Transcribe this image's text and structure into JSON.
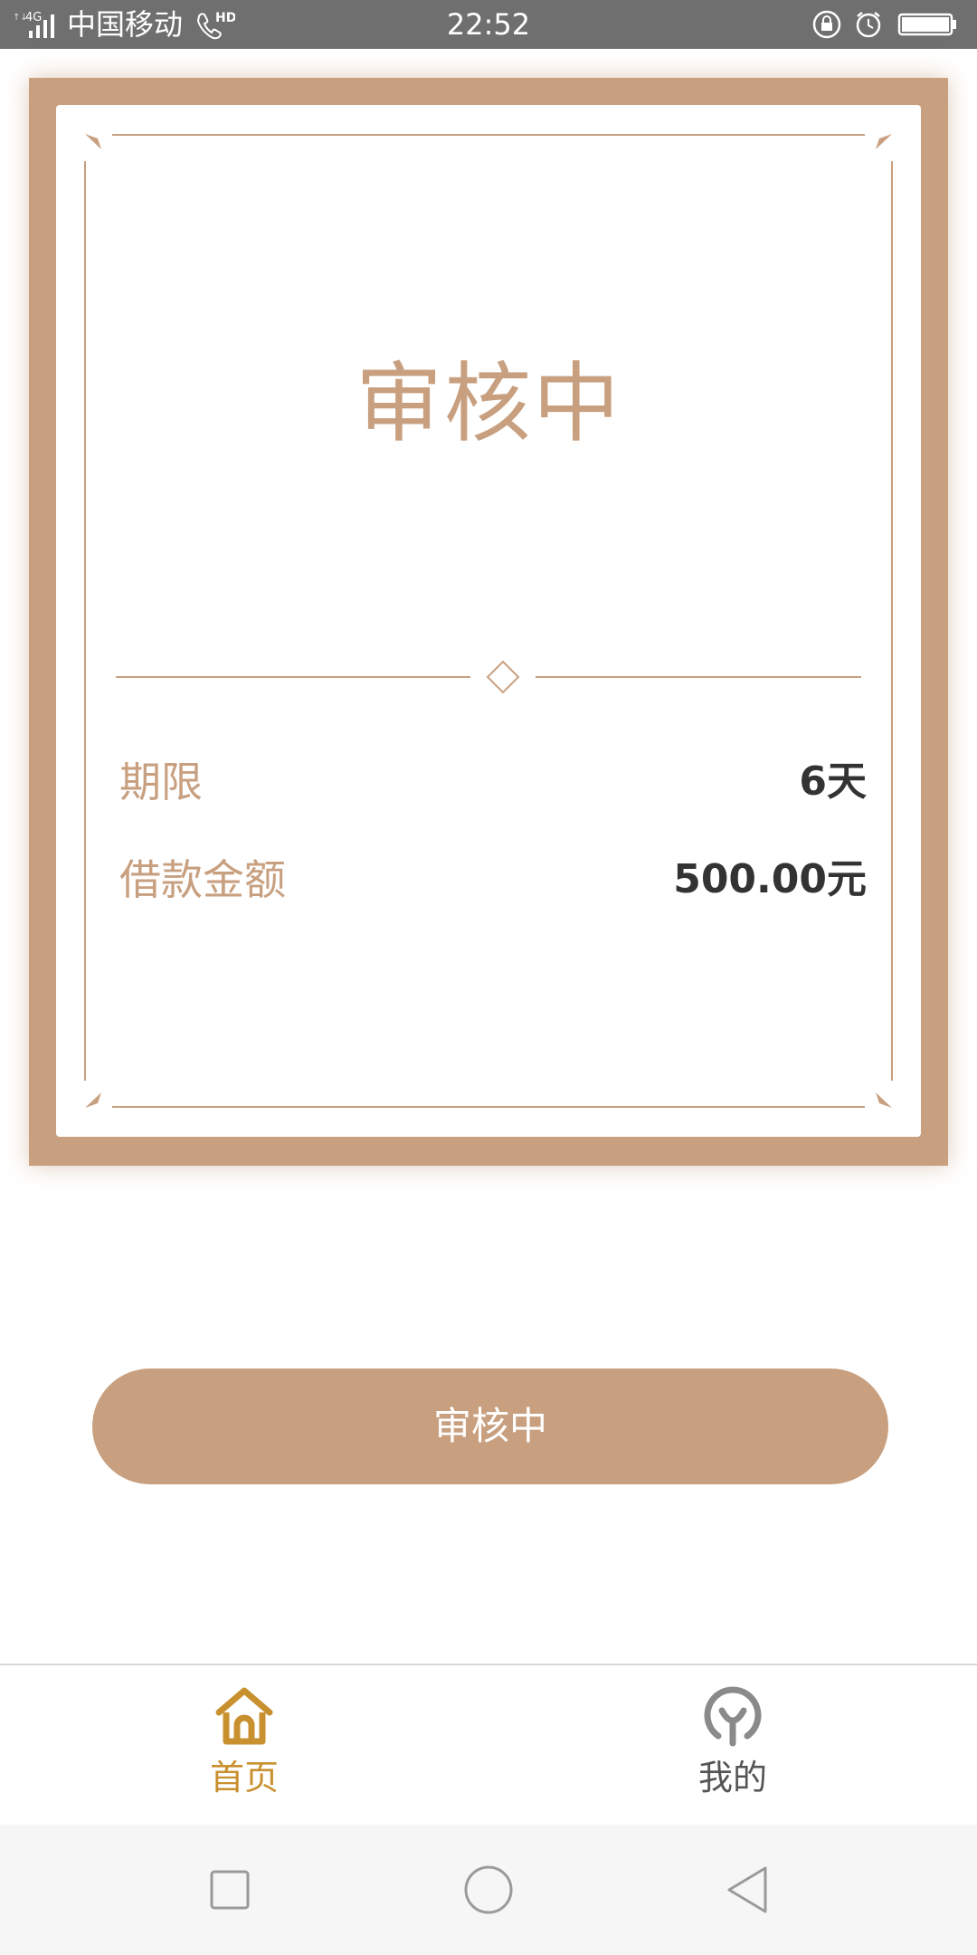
{
  "status_bar": {
    "carrier": "中国移动",
    "time": "22:52",
    "network_label": "4G",
    "hd_label": "HD",
    "icons": [
      "signal-icon",
      "hd-call-icon",
      "lock-rotation-icon",
      "alarm-icon",
      "battery-icon"
    ]
  },
  "card": {
    "status_title": "审核中",
    "rows": [
      {
        "label": "期限",
        "value": "6天"
      },
      {
        "label": "借款金额",
        "value": "500.00元"
      }
    ]
  },
  "action_button": {
    "label": "审核中"
  },
  "tabs": [
    {
      "label": "首页",
      "icon": "home-icon",
      "active": true
    },
    {
      "label": "我的",
      "icon": "profile-icon",
      "active": false
    }
  ],
  "colors": {
    "accent": "#c8a080",
    "tab_active": "#c8902e",
    "tab_inactive": "#8a8a8a",
    "text_dark": "#333333"
  },
  "nav_bar": {
    "buttons": [
      "recent-apps-icon",
      "home-circle-icon",
      "back-icon"
    ]
  }
}
